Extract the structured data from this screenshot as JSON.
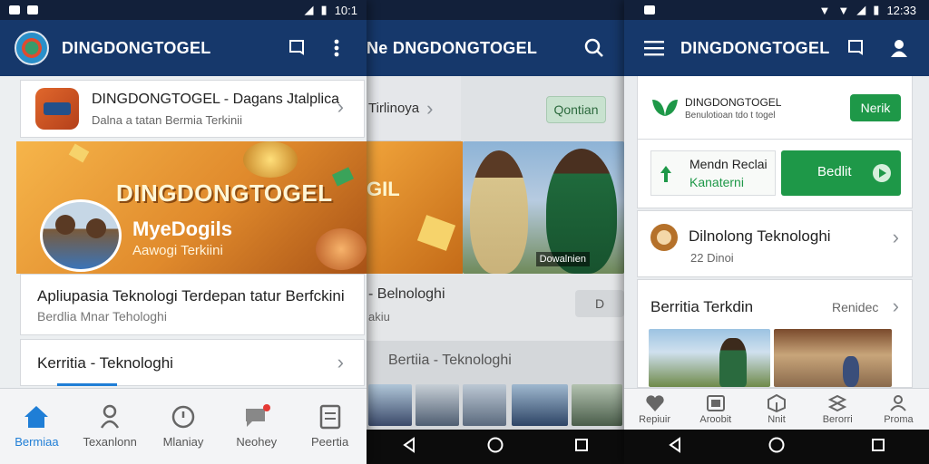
{
  "screen1": {
    "status": {
      "left": "",
      "right": "10:1"
    },
    "appbar": {
      "title": "DINGDONGTOGEL"
    },
    "top_card": {
      "title": "DINGDONGTOGEL - Dagans Jtalplica",
      "subtitle": "Dalna a tatan Bermia Terkinii"
    },
    "banner": {
      "heading": "DINGDONGTOGEL",
      "name": "MyeDogils",
      "tagline": "Aawogi Terkiini"
    },
    "article": {
      "title": "Apliupasia Teknologi Terdepan tatur Berfckini",
      "subtitle": "Berdlia Mnar Tehologhi"
    },
    "section": {
      "title": "Kerritia - Teknologhi"
    },
    "nav": [
      {
        "label": "Bermiaa"
      },
      {
        "label": "Texanlonn"
      },
      {
        "label": "Mlaniay"
      },
      {
        "label": "Neohey"
      },
      {
        "label": "Peertia"
      }
    ],
    "accent": "#1f7ed6"
  },
  "screen2": {
    "appbar": {
      "title": "Ne DNGDONGTOGEL"
    },
    "row1": {
      "label": "Tirlinoya"
    },
    "chip": {
      "label": "Qontian"
    },
    "banner_text": "GIL",
    "photo_caption": "Dowalnien",
    "article": {
      "title": "- Belnologhi",
      "subtitle": "akiu"
    },
    "toggle_label": "D",
    "section": {
      "title": "Bertiia - Teknologhi"
    }
  },
  "screen3": {
    "status": {
      "right": "12:33"
    },
    "appbar": {
      "title": "DINGDONGTOGEL"
    },
    "brand": {
      "name": "DINGDONGTOGEL",
      "sub": "Benulotioan tdo t togel"
    },
    "brand_button": "Nerik",
    "promo": {
      "line1": "Mendn Reclai",
      "line2": "Kanaterni",
      "button": "Bedlit"
    },
    "list_item": {
      "title": "Dilnolong Teknologhi",
      "meta": "22 Dinoi"
    },
    "news": {
      "title": "Berritia Terkdin",
      "more": "Renidec"
    },
    "nav": [
      {
        "label": "Repiuir"
      },
      {
        "label": "Aroobit"
      },
      {
        "label": "Nnit"
      },
      {
        "label": "Berorri"
      },
      {
        "label": "Proma"
      }
    ],
    "green": "#1e9848"
  }
}
